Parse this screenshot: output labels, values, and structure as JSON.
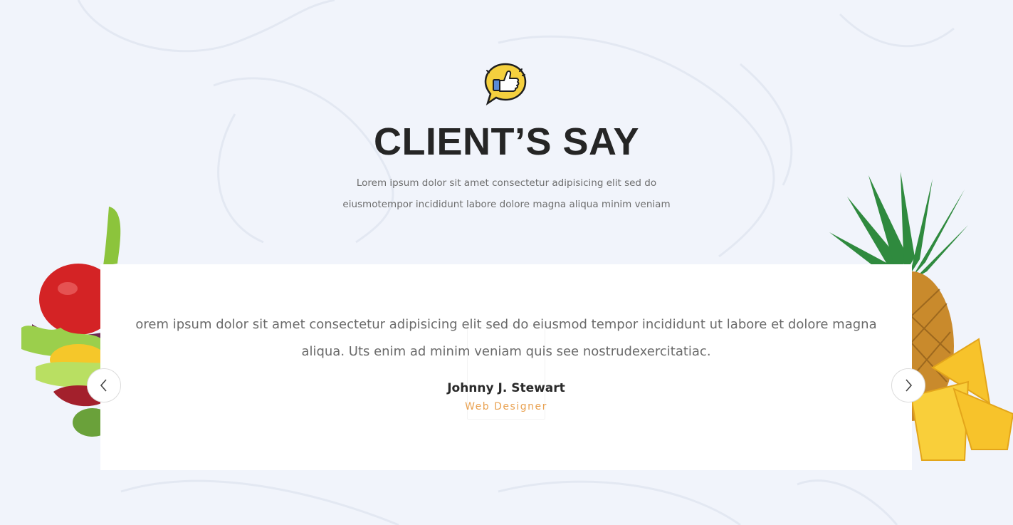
{
  "colors": {
    "background": "#f1f4fb",
    "title": "#252525",
    "text": "#6a6a6a",
    "accent": "#e9a150",
    "card": "#ffffff"
  },
  "icons": {
    "header": "thumbs-up-speech-bubble-icon",
    "prev": "chevron-left-icon",
    "next": "chevron-right-icon"
  },
  "header": {
    "title": "CLIENT’S SAY",
    "subtitle_lines": [
      "Lorem ipsum dolor sit amet consectetur adipisicing elit sed do",
      "eiusmotempor incididunt labore dolore magna aliqua minim veniam"
    ]
  },
  "testimonial": {
    "quote_lines": [
      "orem ipsum dolor sit amet consectetur adipisicing elit sed do eiusmod tempor incididunt ut labore et dolore magna",
      "aliqua. Uts enim ad minim veniam quis see nostrudexercitatiac."
    ],
    "author": "Johnny J. Stewart",
    "role": "Web Designer"
  }
}
